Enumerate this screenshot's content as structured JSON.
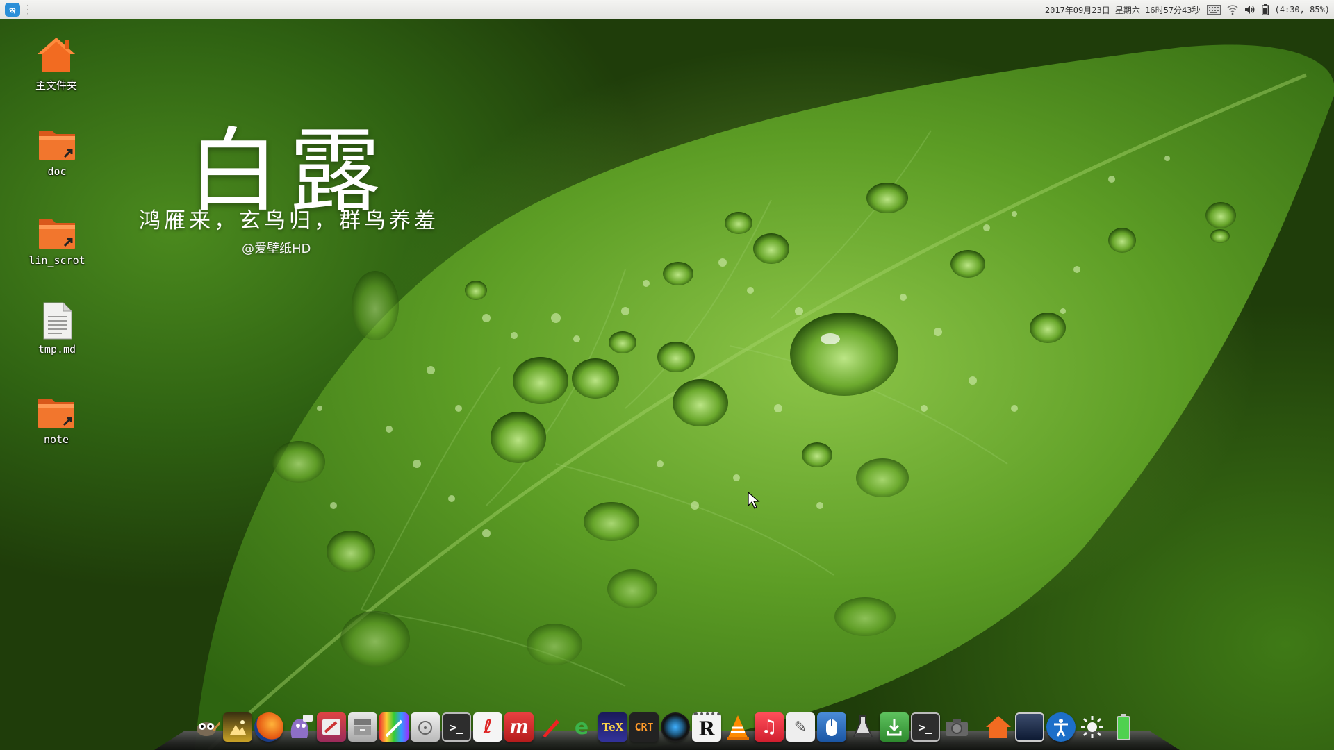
{
  "top_panel": {
    "datetime": "2017年09月23日  星期六  16时57分43秒",
    "battery": "(4:30, 85%)",
    "tray_icons": [
      "keyboard-icon",
      "network-icon",
      "volume-icon",
      "battery-icon"
    ]
  },
  "desktop": {
    "icons": [
      {
        "label": "主文件夹",
        "icon": "home-folder-icon"
      },
      {
        "label": "doc",
        "icon": "folder-link-icon"
      },
      {
        "label": "lin_scrot",
        "icon": "folder-link-icon"
      },
      {
        "label": "tmp.md",
        "icon": "text-file-icon"
      },
      {
        "label": "note",
        "icon": "folder-link-icon"
      }
    ]
  },
  "wallpaper": {
    "title": "白露",
    "poem": "鸿雁来，玄鸟归，群鸟养羞",
    "credit": "@爱壁纸HD"
  },
  "dock": {
    "items": [
      "gimp-icon",
      "image-viewer-icon",
      "firefox-icon",
      "pidgin-icon",
      "gnome-tweak-icon",
      "file-manager-icon",
      "color-palette-icon",
      "disk-utility-icon",
      "terminal-icon",
      "pdf-reader-icon",
      "mathematica-icon",
      "drawing-pen-icon",
      "ebook-reader-icon",
      "texmaker-icon",
      "securecrt-icon",
      "camera-app-icon",
      "r-studio-icon",
      "vlc-icon",
      "music-player-icon",
      "text-editor-icon",
      "mouse-settings-icon",
      "chemistry-app-icon",
      "download-manager-icon",
      "terminal-icon-2",
      "screenshot-icon",
      "home-folder-dock-icon",
      "show-desktop-icon",
      "accessibility-icon",
      "brightness-icon",
      "battery-dock-icon"
    ],
    "colors": {
      "accent": "#2b8fd8",
      "shelf": "#262626"
    }
  }
}
